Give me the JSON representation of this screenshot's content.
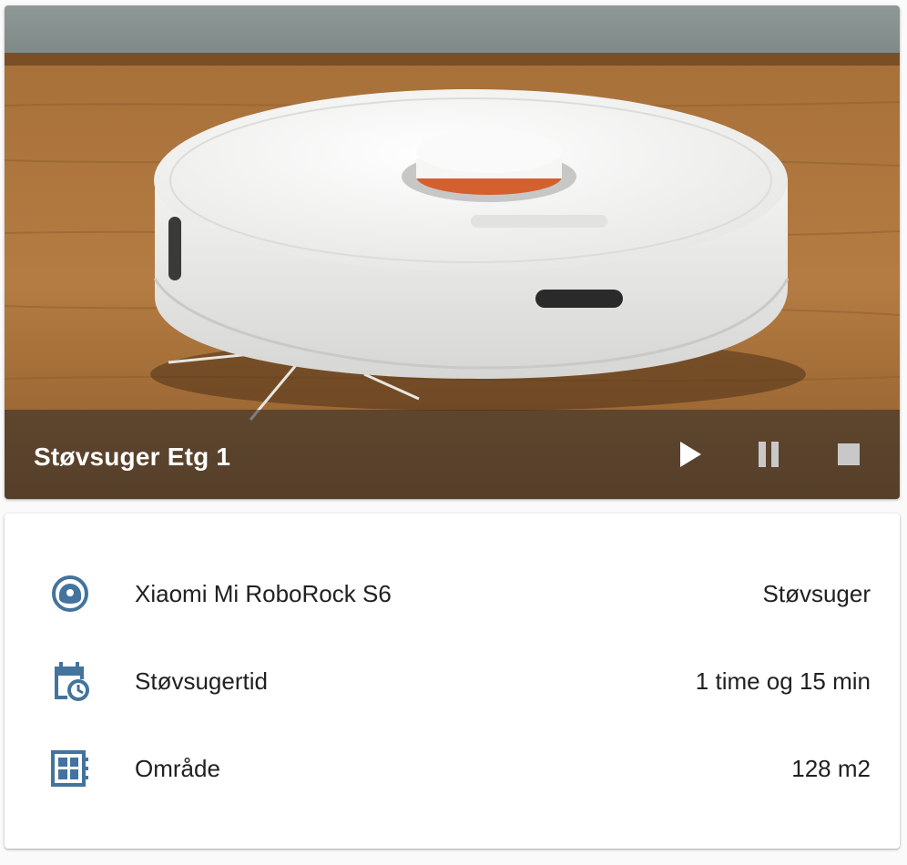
{
  "media": {
    "title": "Støvsuger Etg 1",
    "controls": {
      "play_icon": "play-icon",
      "pause_icon": "pause-icon",
      "stop_icon": "stop-icon"
    }
  },
  "info": {
    "rows": [
      {
        "icon": "robot-vacuum-icon",
        "label": "Xiaomi Mi RoboRock S6",
        "value": "Støvsuger"
      },
      {
        "icon": "calendar-clock-icon",
        "label": "Støvsugertid",
        "value": "1 time og 15 min"
      },
      {
        "icon": "floor-plan-icon",
        "label": "Område",
        "value": "128 m2"
      }
    ]
  },
  "colors": {
    "icon": "#44739e",
    "text": "#212121",
    "overlay": "rgba(40,40,40,0.55)"
  }
}
